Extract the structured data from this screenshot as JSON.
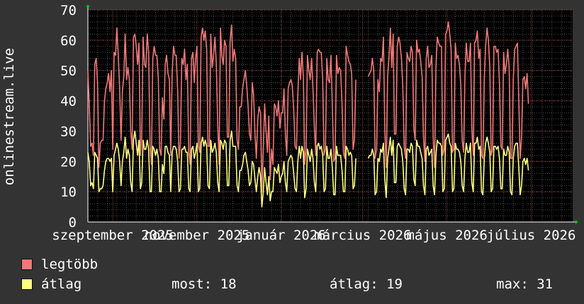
{
  "chart_data": {
    "type": "line",
    "ylabel": "onlinestream.live",
    "ylim": [
      0,
      70
    ],
    "yticks": [
      0,
      10,
      20,
      30,
      40,
      50,
      60,
      70
    ],
    "xlim": [
      "2025-08-14",
      "2026-07-31"
    ],
    "xticks": [
      {
        "date": "2025-09-01",
        "label": "szeptember 2025"
      },
      {
        "date": "2025-11-01",
        "label": "november 2025"
      },
      {
        "date": "2026-01-01",
        "label": "január 2026"
      },
      {
        "date": "2026-03-01",
        "label": "március 2026"
      },
      {
        "date": "2026-05-01",
        "label": "május 2026"
      },
      {
        "date": "2026-07-01",
        "label": "július 2026"
      }
    ],
    "grid": true,
    "series": [
      {
        "name": "legtöbb",
        "color": "#f07878",
        "start": "2025-08-14",
        "values": [
          50,
          39,
          25,
          26,
          22,
          52,
          54,
          46,
          18,
          26,
          27,
          27,
          40,
          44,
          46,
          49,
          43,
          50,
          24,
          56,
          55,
          64,
          55,
          44,
          27,
          43,
          48,
          62,
          47,
          51,
          47,
          30,
          24,
          61,
          62,
          58,
          52,
          59,
          22,
          28,
          61,
          52,
          51,
          62,
          56,
          25,
          19,
          54,
          58,
          55,
          55,
          47,
          24,
          22,
          41,
          34,
          52,
          55,
          49,
          47,
          22,
          49,
          58,
          55,
          55,
          43,
          21,
          26,
          54,
          52,
          57,
          47,
          52,
          23,
          19,
          54,
          56,
          46,
          54,
          58,
          25,
          23,
          61,
          64,
          60,
          63,
          57,
          25,
          25,
          62,
          51,
          55,
          61,
          52,
          32,
          19,
          64,
          55,
          52,
          60,
          58,
          28,
          28,
          60,
          65,
          53,
          57,
          54,
          27,
          24,
          38,
          38,
          44,
          47,
          50,
          45,
          38,
          29,
          27,
          46,
          42,
          29,
          21,
          34,
          38,
          36,
          10,
          24,
          39,
          30,
          23,
          35,
          14,
          24,
          19,
          39,
          38,
          35,
          40,
          31,
          36,
          36,
          44,
          29,
          22,
          44,
          46,
          47,
          45,
          37,
          25,
          24,
          42,
          54,
          47,
          56,
          48,
          19,
          24,
          55,
          50,
          47,
          54,
          44,
          31,
          22,
          56,
          57,
          56,
          56,
          47,
          22,
          24,
          54,
          47,
          46,
          55,
          38,
          20,
          21,
          55,
          49,
          51,
          50,
          39,
          23,
          21,
          58,
          55,
          53,
          52,
          49,
          24,
          27,
          47,
          null,
          null,
          null,
          null,
          null,
          null,
          null,
          null,
          48,
          49,
          50,
          54,
          50,
          21,
          24,
          47,
          43,
          54,
          53,
          61,
          30,
          18,
          48,
          54,
          64,
          51,
          62,
          29,
          29,
          58,
          61,
          59,
          54,
          45,
          25,
          21,
          56,
          54,
          53,
          58,
          56,
          31,
          27,
          60,
          56,
          57,
          53,
          48,
          28,
          20,
          54,
          58,
          51,
          52,
          55,
          28,
          18,
          51,
          61,
          59,
          58,
          58,
          22,
          24,
          62,
          63,
          66,
          62,
          57,
          23,
          24,
          59,
          54,
          55,
          52,
          45,
          27,
          23,
          48,
          59,
          53,
          53,
          59,
          31,
          22,
          59,
          60,
          63,
          54,
          57,
          22,
          21,
          47,
          58,
          64,
          60,
          51,
          22,
          24,
          58,
          58,
          56,
          57,
          46,
          25,
          24,
          56,
          49,
          52,
          57,
          51,
          21,
          21,
          47,
          57,
          58,
          59,
          40,
          21,
          28,
          47,
          48,
          44,
          49,
          39
        ]
      },
      {
        "name": "átlag",
        "color": "#ffff80",
        "start": "2025-08-14",
        "values": [
          23,
          20,
          12,
          13,
          11,
          23,
          22,
          21,
          10,
          11,
          11,
          12,
          17,
          20,
          21,
          21,
          20,
          21,
          10,
          22,
          24,
          26,
          24,
          20,
          12,
          20,
          23,
          28,
          21,
          24,
          22,
          13,
          10,
          27,
          30,
          26,
          22,
          27,
          11,
          13,
          27,
          24,
          24,
          27,
          24,
          10,
          10,
          25,
          24,
          22,
          24,
          21,
          10,
          10,
          19,
          16,
          25,
          25,
          23,
          22,
          10,
          23,
          25,
          25,
          24,
          20,
          10,
          11,
          24,
          24,
          25,
          23,
          23,
          11,
          10,
          24,
          25,
          21,
          23,
          26,
          10,
          11,
          26,
          28,
          25,
          27,
          25,
          12,
          11,
          27,
          23,
          24,
          26,
          23,
          13,
          10,
          27,
          26,
          24,
          27,
          26,
          12,
          12,
          27,
          30,
          25,
          25,
          25,
          12,
          10,
          17,
          17,
          19,
          22,
          23,
          20,
          17,
          12,
          13,
          20,
          19,
          14,
          10,
          15,
          18,
          15,
          5,
          10,
          18,
          13,
          9,
          15,
          7,
          10,
          10,
          18,
          17,
          16,
          19,
          13,
          15,
          16,
          20,
          13,
          10,
          20,
          21,
          22,
          21,
          16,
          11,
          10,
          20,
          25,
          21,
          25,
          23,
          8,
          11,
          24,
          22,
          20,
          24,
          21,
          13,
          10,
          25,
          26,
          24,
          25,
          22,
          10,
          11,
          25,
          21,
          21,
          24,
          18,
          9,
          9,
          25,
          22,
          22,
          22,
          17,
          10,
          10,
          25,
          24,
          22,
          23,
          22,
          11,
          12,
          21,
          null,
          null,
          null,
          null,
          null,
          null,
          null,
          null,
          21,
          22,
          22,
          24,
          22,
          9,
          10,
          21,
          20,
          24,
          23,
          26,
          14,
          8,
          21,
          24,
          28,
          22,
          27,
          13,
          13,
          25,
          26,
          25,
          24,
          20,
          11,
          9,
          24,
          24,
          23,
          26,
          25,
          14,
          12,
          27,
          25,
          25,
          23,
          21,
          12,
          9,
          24,
          25,
          22,
          23,
          24,
          12,
          9,
          22,
          27,
          26,
          26,
          25,
          10,
          11,
          27,
          28,
          29,
          26,
          25,
          10,
          11,
          26,
          24,
          24,
          23,
          20,
          12,
          10,
          21,
          26,
          23,
          23,
          26,
          13,
          10,
          26,
          26,
          28,
          24,
          25,
          10,
          9,
          21,
          26,
          28,
          26,
          23,
          10,
          11,
          25,
          25,
          24,
          25,
          21,
          11,
          11,
          24,
          22,
          22,
          25,
          23,
          10,
          9,
          21,
          25,
          26,
          26,
          18,
          9,
          12,
          20,
          21,
          19,
          21,
          17
        ]
      }
    ]
  },
  "legend": {
    "items": [
      {
        "label": "legtöbb",
        "color": "#f07878"
      },
      {
        "label": "átlag",
        "color": "#ffff80"
      }
    ],
    "stats": {
      "now": "most: 18",
      "avg": "átlag: 19",
      "max": "max: 31"
    }
  }
}
